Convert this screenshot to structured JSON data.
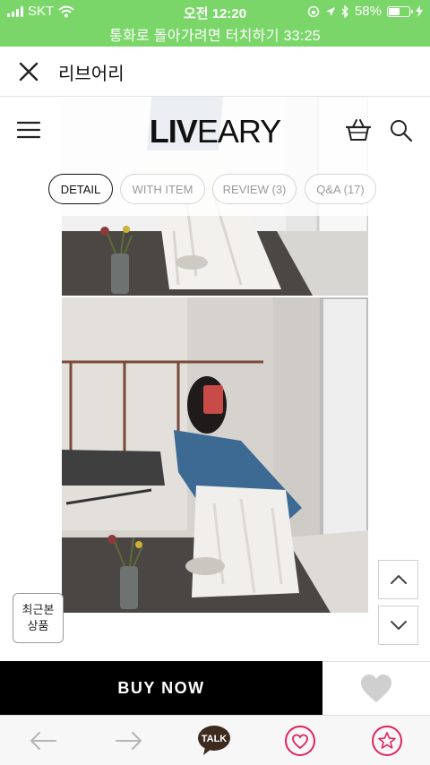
{
  "status_bar": {
    "carrier": "SKT",
    "time": "오전 12:20",
    "battery_percent": "58%",
    "battery_level": 0.58,
    "color": "#7bd66a"
  },
  "call_banner": {
    "text": "통화로 돌아가려면 터치하기 33:25"
  },
  "header": {
    "close_icon": "close-icon",
    "title": "리브어리"
  },
  "site": {
    "logo_bold": "LIV",
    "logo_light": "EARY",
    "menu_icon": "hamburger-icon",
    "cart_icon": "basket-icon",
    "search_icon": "search-icon"
  },
  "tabs": [
    {
      "label": "DETAIL",
      "active": true
    },
    {
      "label": "WITH ITEM",
      "active": false
    },
    {
      "label": "REVIEW (3)",
      "active": false
    },
    {
      "label": "Q&A (17)",
      "active": false
    }
  ],
  "recent": {
    "line1": "최근본",
    "line2": "상품"
  },
  "scroll": {
    "up_icon": "chevron-up-icon",
    "down_icon": "chevron-down-icon"
  },
  "buy": {
    "label": "BUY NOW",
    "wish_icon": "heart-icon"
  },
  "toolbar": {
    "back_icon": "arrow-left-icon",
    "forward_icon": "arrow-right-icon",
    "talk_label": "TALK",
    "favorite_icon": "heart-circle-icon",
    "star_icon": "star-circle-icon",
    "accent_color": "#e0245e"
  }
}
